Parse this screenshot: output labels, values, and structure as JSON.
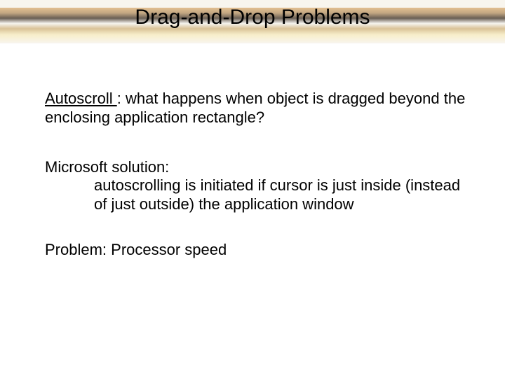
{
  "title": "Drag-and-Drop Problems",
  "block1": {
    "term": "Autoscroll ",
    "rest": ":  what happens when object is dragged beyond the enclosing application rectangle?"
  },
  "block2": {
    "lead": " Microsoft solution:",
    "detail": "autoscrolling is initiated if cursor is just inside (instead of just outside) the application window"
  },
  "block3": "Problem:  Processor speed"
}
